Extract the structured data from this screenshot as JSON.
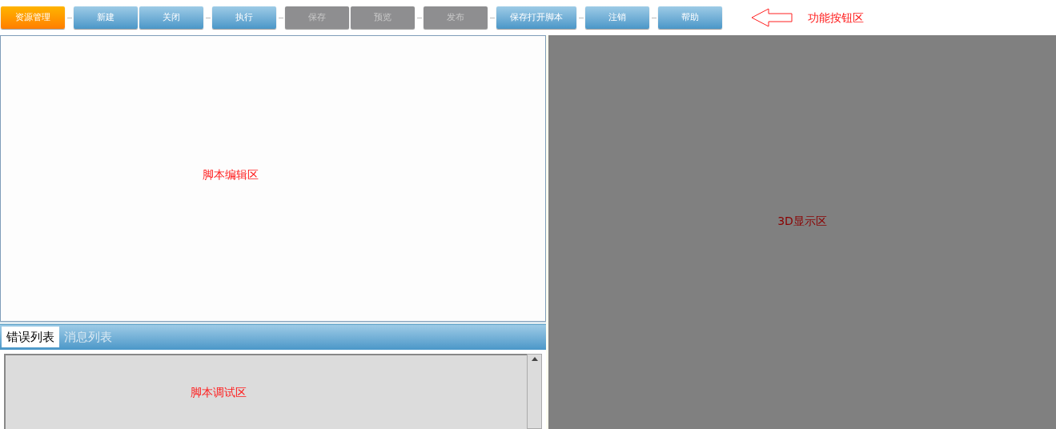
{
  "toolbar": {
    "groups": [
      [
        {
          "label": "资源管理",
          "kind": "primary"
        }
      ],
      [
        {
          "label": "新建",
          "kind": "normal"
        },
        {
          "label": "关闭",
          "kind": "normal"
        }
      ],
      [
        {
          "label": "执行",
          "kind": "normal"
        }
      ],
      [
        {
          "label": "保存",
          "kind": "disabled"
        },
        {
          "label": "预览",
          "kind": "disabled"
        }
      ],
      [
        {
          "label": "发布",
          "kind": "disabled"
        }
      ],
      [
        {
          "label": "保存打开脚本",
          "kind": "normal"
        }
      ],
      [
        {
          "label": "注销",
          "kind": "normal"
        }
      ],
      [
        {
          "label": "帮助",
          "kind": "normal"
        }
      ]
    ],
    "annotation": "功能按钮区"
  },
  "editor": {
    "annotation": "脚本编辑区"
  },
  "tabs": [
    {
      "label": "错误列表",
      "selected": true
    },
    {
      "label": "消息列表",
      "selected": false
    }
  ],
  "debug": {
    "annotation": "脚本调试区"
  },
  "viewport": {
    "annotation": "3D显示区"
  }
}
